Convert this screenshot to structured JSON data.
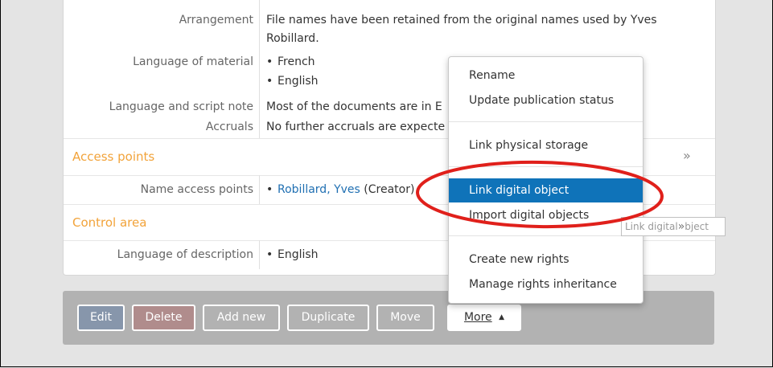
{
  "fields": {
    "arrangement": {
      "label": "Arrangement",
      "line1": "File names have been retained from the original names used by Yves",
      "line2": "Robillard."
    },
    "language_of_material": {
      "label": "Language of material",
      "items": [
        "French",
        "English"
      ]
    },
    "language_script_note": {
      "label": "Language and script note",
      "value": "Most of the documents are in E"
    },
    "accruals": {
      "label": "Accruals",
      "value": "No further accruals are expecte"
    }
  },
  "access_points": {
    "title": "Access points",
    "chevron": "»",
    "name_access_label": "Name access points",
    "name_access_link": "Robillard, Yves",
    "name_access_role": "(Creator)"
  },
  "control_area": {
    "title": "Control area",
    "language_label": "Language of description",
    "language_value": "English"
  },
  "menu": {
    "items": [
      "Rename",
      "Update publication status",
      "Link physical storage",
      "Link digital object",
      "Import digital objects",
      "Create new rights",
      "Manage rights inheritance"
    ]
  },
  "tooltip": {
    "text": "Link digital",
    "chevron": "»",
    "text_end": "bject"
  },
  "actions": {
    "edit": "Edit",
    "delete": "Delete",
    "add_new": "Add new",
    "duplicate": "Duplicate",
    "move": "Move",
    "more": "More",
    "more_caret": "▲"
  },
  "colors": {
    "accent": "#f2a33a",
    "link": "#1f6fb2",
    "menu_active": "#0f73b9",
    "edit_button": "#8796ab",
    "delete_button": "#b08c8c",
    "highlight_ellipse": "#e0201b"
  }
}
